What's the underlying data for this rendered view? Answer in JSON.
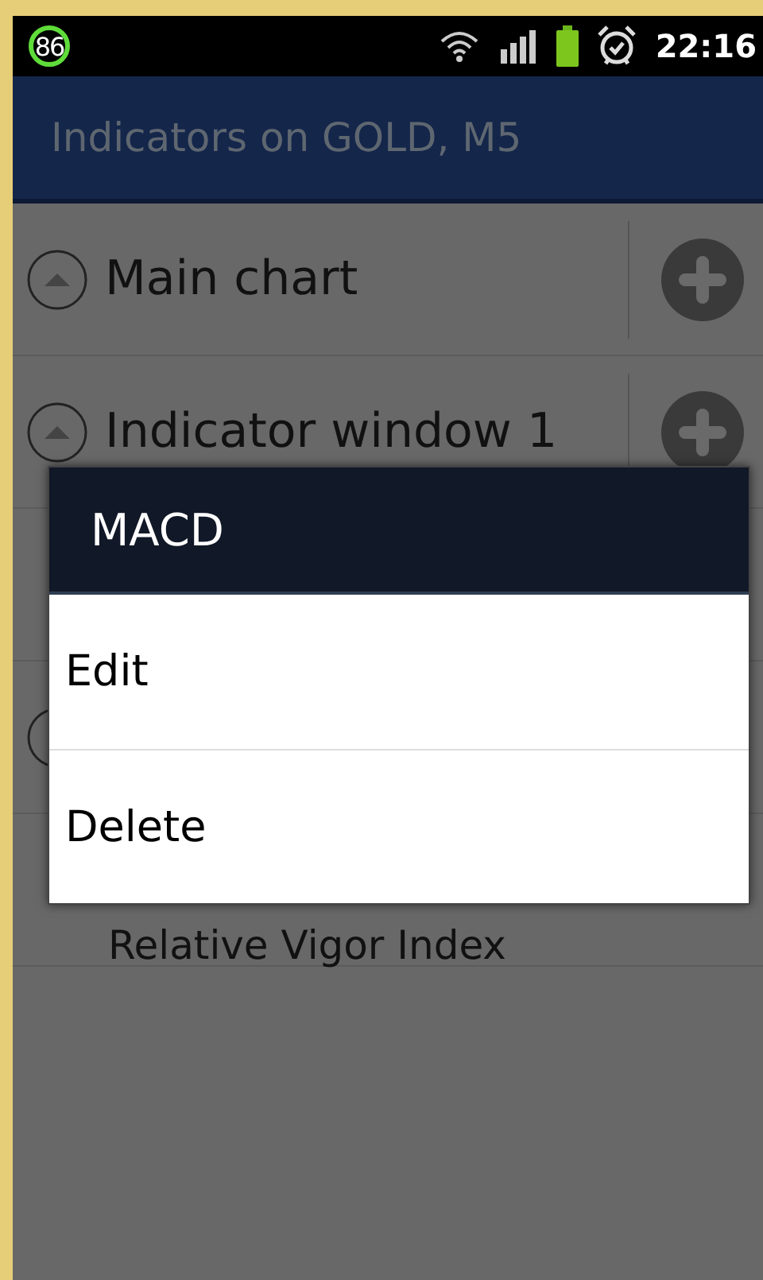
{
  "status_bar": {
    "badge": "86",
    "time": "22:16"
  },
  "action_bar": {
    "title": "Indicators on GOLD, M5"
  },
  "list": {
    "rows": [
      {
        "kind": "window",
        "title": "Main chart",
        "expanded": true
      },
      {
        "kind": "window",
        "title": "Indicator window 1",
        "expanded": true
      },
      {
        "kind": "indicator"
      },
      {
        "kind": "window"
      },
      {
        "kind": "indicator",
        "title": "Relative Vigor Index"
      }
    ]
  },
  "dialog": {
    "title": "MACD",
    "items": [
      "Edit",
      "Delete"
    ]
  }
}
